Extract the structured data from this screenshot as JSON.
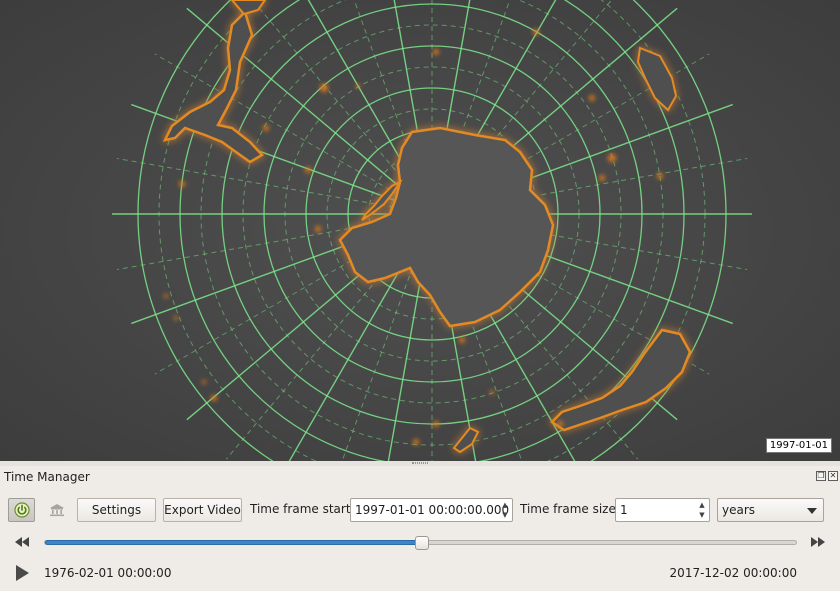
{
  "map": {
    "date_label": "1997-01-01",
    "colors": {
      "background": "#474747",
      "land": "#575757",
      "coast_glow": "#e0841d",
      "graticule": "#7de88c"
    }
  },
  "panel": {
    "title": "Time Manager",
    "controls": {
      "float_icon": "float-icon",
      "close_icon": "close-icon"
    }
  },
  "toolbar": {
    "power_icon": "power-icon",
    "archive_icon": "archive-icon",
    "settings_label": "Settings",
    "export_label": "Export Video",
    "time_frame_start_label": "Time frame start",
    "time_frame_start_value": "1997-01-01 00:00:00.000",
    "time_frame_size_label": "Time frame size",
    "time_frame_size_value": "1",
    "unit_value": "years"
  },
  "slider": {
    "position_fraction": 0.5,
    "accent": "#3a86c8"
  },
  "playback": {
    "start": "1976-02-01 00:00:00",
    "end": "2017-12-02 00:00:00"
  }
}
